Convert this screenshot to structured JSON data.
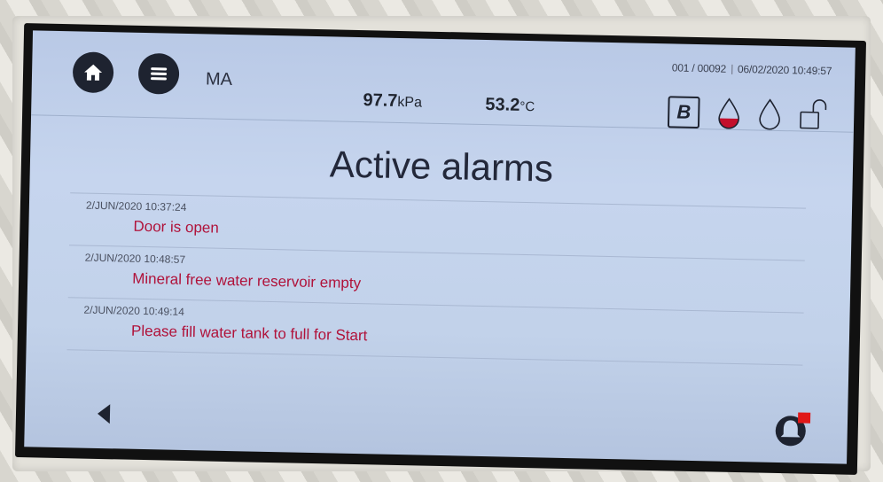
{
  "header": {
    "user": "MA",
    "counter": "001 / 00092",
    "datetime": "06/02/2020 10:49:57",
    "pressure_value": "97.7",
    "pressure_unit": "kPa",
    "temperature_value": "53.2",
    "temperature_unit": "°C",
    "mode_letter": "B"
  },
  "icons": {
    "home": "home-icon",
    "menu": "menu-icon",
    "water_level_low": "water-drop-partial-icon",
    "water_empty": "water-drop-empty-icon",
    "lock": "unlock-icon",
    "back": "back-arrow-icon",
    "alarm": "alarm-bell-icon"
  },
  "colors": {
    "alarm_text": "#b0123a",
    "screen_bg": "#c2d2ea",
    "alarm_indicator": "#e01818"
  },
  "page": {
    "title": "Active alarms"
  },
  "alarms": [
    {
      "timestamp": "2/JUN/2020 10:37:24",
      "message": "Door is open"
    },
    {
      "timestamp": "2/JUN/2020 10:48:57",
      "message": "Mineral free water reservoir empty"
    },
    {
      "timestamp": "2/JUN/2020 10:49:14",
      "message": "Please fill water tank to full for Start"
    }
  ]
}
